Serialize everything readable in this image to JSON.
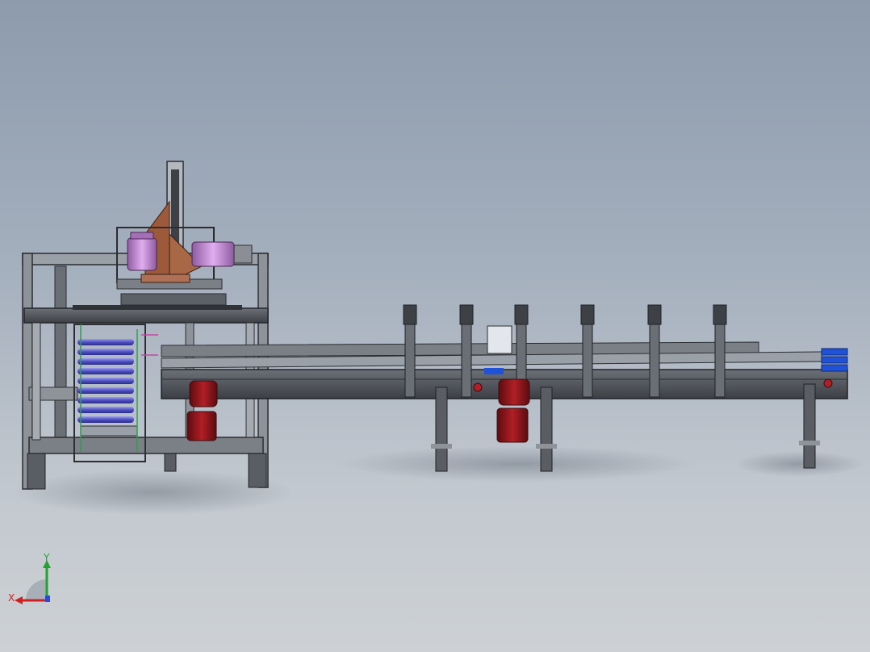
{
  "view": {
    "background_top": "#8d9bad",
    "background_bottom": "#cdd1d5",
    "model_type": "packaging conveyor line assembly",
    "orientation": "front"
  },
  "triad": {
    "x_label": "X",
    "y_label": "Y",
    "x_color": "#d31f1f",
    "y_color": "#1fa52b",
    "z_color": "#2a4bd7"
  },
  "colors": {
    "frame": "#4a4d52",
    "frame_light": "#8e939a",
    "motor_red": "#8e1418",
    "motor_pink": "#c48ad1",
    "copper": "#9c5a3a",
    "rollers_blue": "#4e4fc3",
    "accent_blue": "#1f52d8"
  }
}
